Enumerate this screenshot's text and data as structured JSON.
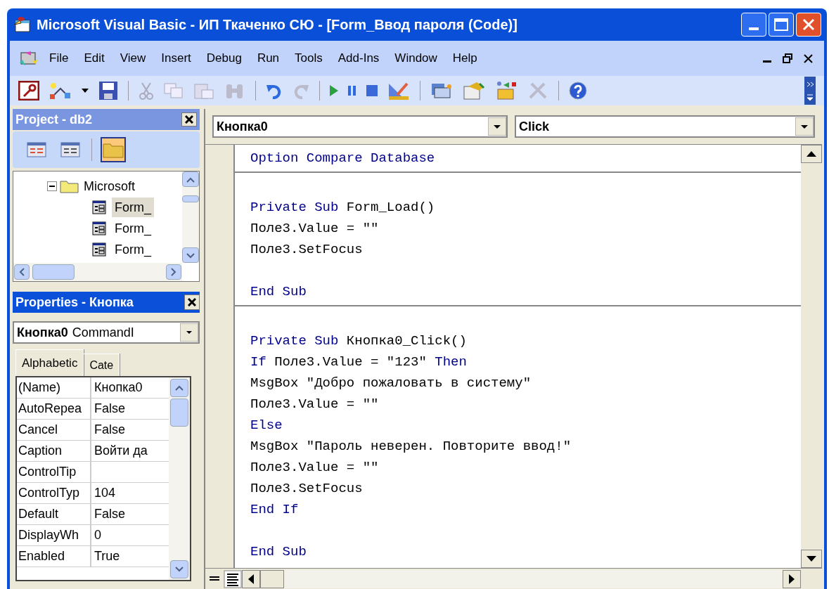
{
  "window": {
    "title": "Microsoft Visual Basic - ИП Ткаченко СЮ - [Form_Ввод пароля (Code)]"
  },
  "menu": [
    "File",
    "Edit",
    "View",
    "Insert",
    "Debug",
    "Run",
    "Tools",
    "Add-Ins",
    "Window",
    "Help"
  ],
  "project": {
    "title": "Project - db2",
    "toolbar": [
      {
        "selected": false
      },
      {
        "selected": false
      },
      {
        "selected": true
      }
    ],
    "tree": [
      {
        "label": "Microsoft",
        "expanded": true,
        "selected": false,
        "children": [
          {
            "label": "Form_",
            "selected": true
          },
          {
            "label": "Form_",
            "selected": false
          },
          {
            "label": "Form_",
            "selected": false
          }
        ]
      }
    ]
  },
  "properties": {
    "title": "Properties - Кнопка",
    "object": {
      "name": "Кнопка0",
      "type": "CommandI"
    },
    "tabs": [
      {
        "label": "Alphabetic",
        "selected": true
      },
      {
        "label": "Cate",
        "selected": false
      }
    ],
    "rows": [
      {
        "name": "(Name)",
        "value": "Кнопка0"
      },
      {
        "name": "AutoRepea",
        "value": "False"
      },
      {
        "name": "Cancel",
        "value": "False"
      },
      {
        "name": "Caption",
        "value": "Войти да"
      },
      {
        "name": "ControlTip"
      },
      {
        "name": "ControlTyp",
        "value": "104"
      },
      {
        "name": "Default",
        "value": "False"
      },
      {
        "name": "DisplayWh",
        "value": "0"
      },
      {
        "name": "Enabled",
        "value": "True"
      }
    ]
  },
  "code": {
    "object": "Кнопка0",
    "procedure": "Click",
    "sections": [
      [
        [
          {
            "text": "Option Compare Database",
            "kind": "keyword"
          }
        ]
      ],
      [
        {
          "gap_before": true,
          "tokens": [
            {
              "text": "Private Sub",
              "kind": "keyword"
            },
            {
              "text": " Form_Load()",
              "kind": "plain"
            }
          ]
        },
        [
          {
            "text": "Поле3.Value = \"\"",
            "kind": "plain"
          }
        ],
        [
          {
            "text": "Поле3.SetFocus",
            "kind": "plain"
          }
        ],
        {
          "gap_before": true,
          "tokens": [
            {
              "text": "End Sub",
              "kind": "keyword"
            }
          ]
        }
      ],
      [
        {
          "gap_before": true,
          "tokens": [
            {
              "text": "Private Sub",
              "kind": "keyword"
            },
            {
              "text": " Кнопка0_Click()",
              "kind": "plain"
            }
          ]
        },
        [
          {
            "text": "If",
            "kind": "keyword"
          },
          {
            "text": " Поле3.Value = \"123\" ",
            "kind": "plain"
          },
          {
            "text": "Then",
            "kind": "keyword"
          }
        ],
        [
          {
            "text": "MsgBox \"Добро пожаловать в систему\"",
            "kind": "plain"
          }
        ],
        [
          {
            "text": "Поле3.Value = \"\"",
            "kind": "plain"
          }
        ],
        [
          {
            "text": "Else",
            "kind": "keyword"
          }
        ],
        [
          {
            "text": "MsgBox \"Пароль неверен. Повторите ввод!\"",
            "kind": "plain"
          }
        ],
        [
          {
            "text": "Поле3.Value = \"\"",
            "kind": "plain"
          }
        ],
        [
          {
            "text": "Поле3.SetFocus",
            "kind": "plain"
          }
        ],
        [
          {
            "text": "End If",
            "kind": "keyword"
          }
        ],
        {
          "gap_before": true,
          "tokens": [
            {
              "text": "End Sub",
              "kind": "keyword"
            }
          ]
        }
      ]
    ]
  }
}
